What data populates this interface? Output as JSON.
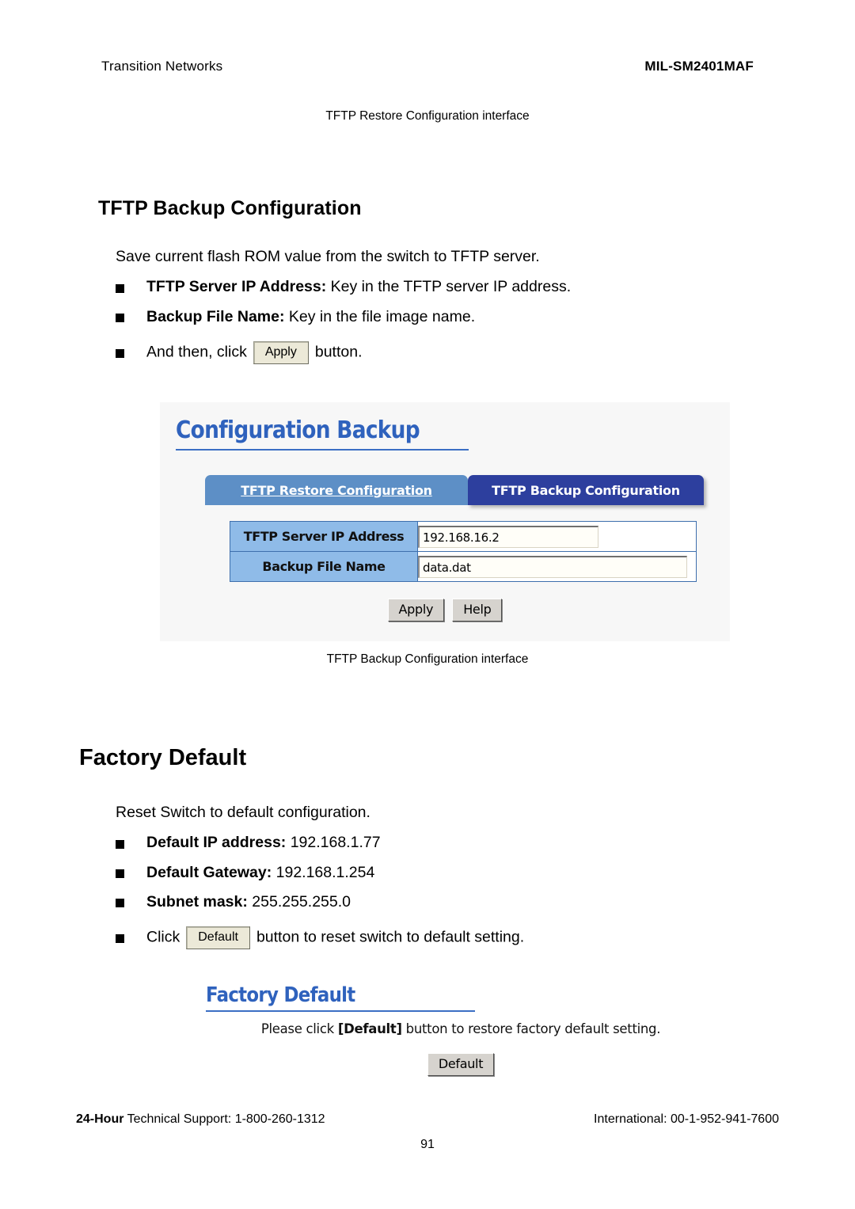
{
  "header": {
    "left": "Transition Networks",
    "right": "MIL-SM2401MAF"
  },
  "captions": {
    "top": "TFTP Restore Configuration interface",
    "middle": "TFTP Backup Configuration interface"
  },
  "backup_section": {
    "heading": "TFTP Backup Configuration",
    "lead": "Save current flash ROM value from the switch to TFTP server.",
    "bullets": [
      {
        "bold": "TFTP Server IP Address:",
        "rest": " Key in the TFTP server IP address."
      },
      {
        "bold": "Backup File Name:",
        "rest": " Key in the file image name."
      }
    ],
    "click_bullet": {
      "before": "And then, click",
      "button": "Apply",
      "after": "button."
    }
  },
  "backup_ui": {
    "title": "Configuration Backup",
    "tabs": [
      {
        "label": "TFTP Restore Configuration",
        "active": false
      },
      {
        "label": "TFTP Backup Configuration",
        "active": true
      }
    ],
    "fields": [
      {
        "label": "TFTP Server IP Address",
        "value": "192.168.16.2"
      },
      {
        "label": "Backup File Name",
        "value": "data.dat"
      }
    ],
    "buttons": [
      "Apply",
      "Help"
    ]
  },
  "factory_section": {
    "heading": "Factory Default",
    "lead": "Reset Switch to default configuration.",
    "bullets": [
      {
        "bold": "Default IP address:",
        "rest": " 192.168.1.77"
      },
      {
        "bold": "Default Gateway:",
        "rest": " 192.168.1.254"
      },
      {
        "bold": "Subnet mask:",
        "rest": " 255.255.255.0"
      }
    ],
    "click_bullet": {
      "before": "Click",
      "button": "Default",
      "after": "button to reset switch to default setting."
    }
  },
  "factory_ui": {
    "title": "Factory Default",
    "message_before": "Please click ",
    "message_bold": "[Default]",
    "message_after": " button to restore factory default setting.",
    "button": "Default"
  },
  "footer": {
    "left_bold": "24-Hour",
    "left_rest": " Technical Support: 1-800-260-1312",
    "right": "International: 00-1-952-941-7600",
    "page": "91"
  },
  "colors": {
    "tab_active": "#2d3f9e",
    "tab_inactive": "#5d8fc6",
    "label_cell": "#8fbbe8",
    "panel_title": "#2f62bd",
    "panel_bg": "#f7f7f7"
  }
}
